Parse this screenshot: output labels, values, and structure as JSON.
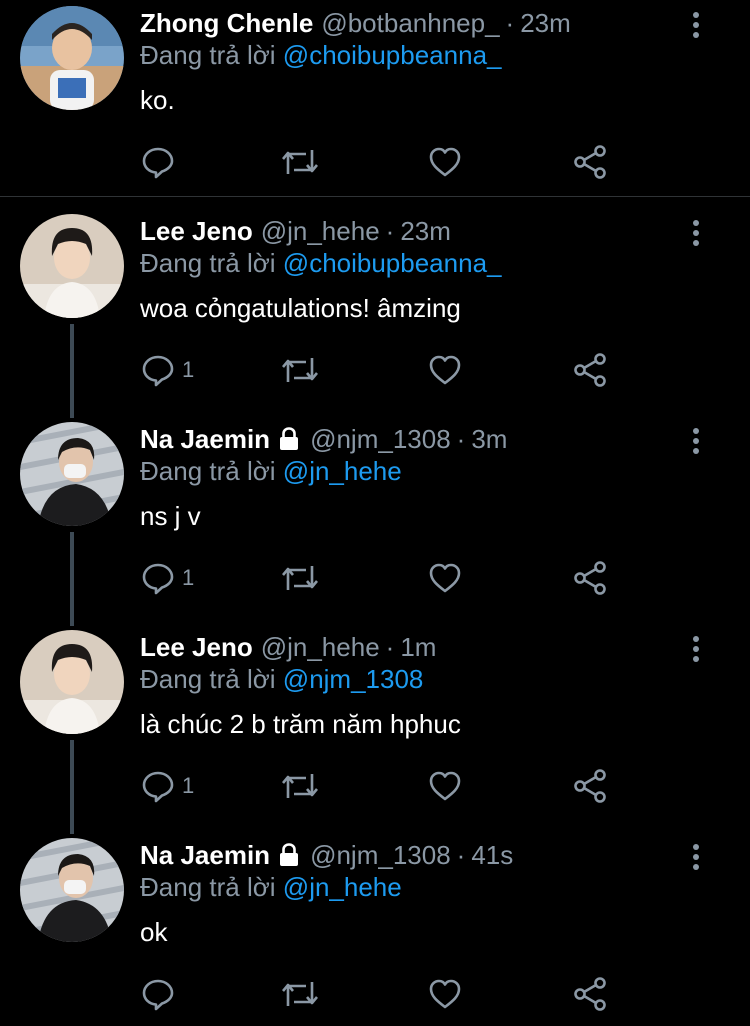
{
  "reply_prefix": "Đang trả lời",
  "tweets": [
    {
      "name": "Zhong Chenle",
      "handle": "@botbanhnep_",
      "separator": "·",
      "time": "23m",
      "reply_to": "@choibupbeanna_",
      "text": "ko.",
      "reply_count": "",
      "locked": false
    },
    {
      "name": "Lee Jeno",
      "handle": "@jn_hehe",
      "separator": "·",
      "time": "23m",
      "reply_to": "@choibupbeanna_",
      "text": "woa cỏngatulations! âmzing",
      "reply_count": "1",
      "locked": false
    },
    {
      "name": "Na Jaemin",
      "handle": "@njm_1308",
      "separator": "·",
      "time": "3m",
      "reply_to": "@jn_hehe",
      "text": "ns j v",
      "reply_count": "1",
      "locked": true
    },
    {
      "name": "Lee Jeno",
      "handle": "@jn_hehe",
      "separator": "·",
      "time": "1m",
      "reply_to": "@njm_1308",
      "text": "là chúc 2 b trăm năm hphuc",
      "reply_count": "1",
      "locked": false
    },
    {
      "name": "Na Jaemin",
      "handle": "@njm_1308",
      "separator": "·",
      "time": "41s",
      "reply_to": "@jn_hehe",
      "text": "ok",
      "reply_count": "",
      "locked": true
    }
  ],
  "icons": {
    "reply": "reply-icon",
    "retweet": "retweet-icon",
    "like": "heart-icon",
    "share": "share-icon",
    "more": "more-vertical-icon",
    "lock": "lock-icon"
  },
  "colors": {
    "background": "#000000",
    "text_primary": "#ffffff",
    "text_secondary": "#8b98a5",
    "mention": "#1d9bf0",
    "thread_line": "#3d4a55",
    "divider": "#2f3336"
  }
}
